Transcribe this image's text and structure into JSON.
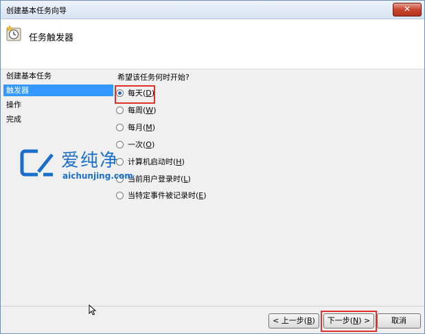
{
  "window": {
    "title": "创建基本任务向导",
    "close_label": "✕"
  },
  "header": {
    "title": "任务触发器",
    "icon": "clock-icon"
  },
  "sidebar": {
    "items": [
      {
        "label": "创建基本任务",
        "active": false
      },
      {
        "label": "触发器",
        "active": true
      },
      {
        "label": "操作",
        "active": false
      },
      {
        "label": "完成",
        "active": false
      }
    ]
  },
  "content": {
    "question": "希望该任务何时开始?",
    "options": [
      {
        "label": "每天(",
        "key": "D",
        "suffix": ")",
        "checked": true
      },
      {
        "label": "每周(",
        "key": "W",
        "suffix": ")",
        "checked": false
      },
      {
        "label": "每月(",
        "key": "M",
        "suffix": ")",
        "checked": false
      },
      {
        "label": "一次(",
        "key": "O",
        "suffix": ")",
        "checked": false
      },
      {
        "label": "计算机启动时(",
        "key": "H",
        "suffix": ")",
        "checked": false
      },
      {
        "label": "当前用户登录时(",
        "key": "L",
        "suffix": ")",
        "checked": false
      },
      {
        "label": "当特定事件被记录时(",
        "key": "E",
        "suffix": ")",
        "checked": false
      }
    ]
  },
  "watermark": {
    "text": "爱纯净",
    "url": "aichunjing.com"
  },
  "buttons": {
    "back": {
      "label": "< 上一步(",
      "key": "B",
      "suffix": ")"
    },
    "next": {
      "label": "下一步(",
      "key": "N",
      "suffix": ") >"
    },
    "cancel": {
      "label": "取消"
    }
  },
  "colors": {
    "highlight": "#e0302a",
    "selection": "#3399ff",
    "watermark": "#1b6fcb"
  }
}
